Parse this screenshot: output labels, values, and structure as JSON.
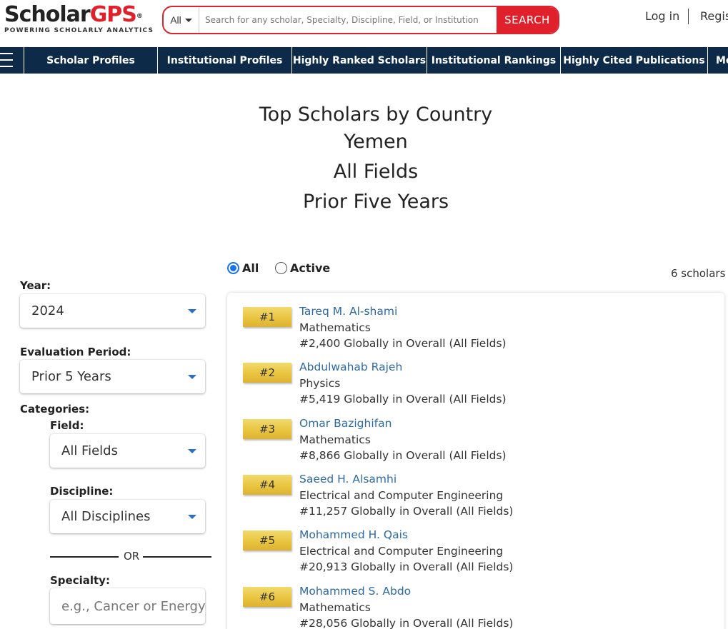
{
  "brand": {
    "name_part1": "Scholar",
    "name_part2": "GPS",
    "reg": "®",
    "tagline": "POWERING SCHOLARLY ANALYTICS"
  },
  "search": {
    "scope": "All",
    "placeholder": "Search for any scholar, Specialty, Discipline, Field, or Institution",
    "button": "SEARCH",
    "value": ""
  },
  "auth": {
    "login": "Log in",
    "register": "Register"
  },
  "nav": {
    "items": [
      "Scholar Profiles",
      "Institutional Profiles",
      "Highly Ranked Scholars",
      "Institutional Rankings",
      "Highly Cited Publications",
      "More"
    ]
  },
  "page": {
    "title": "Top Scholars by Country",
    "country": "Yemen",
    "field": "All Fields",
    "period": "Prior Five Years"
  },
  "filters": {
    "year_label": "Year:",
    "year_value": "2024",
    "eval_label": "Evaluation Period:",
    "eval_value": "Prior 5 Years",
    "categories_label": "Categories:",
    "field_label": "Field:",
    "field_value": "All Fields",
    "discipline_label": "Discipline:",
    "discipline_value": "All Disciplines",
    "or_text": "OR",
    "specialty_label": "Specialty:",
    "specialty_placeholder": "e.g., Cancer or Energy"
  },
  "toggle": {
    "all": "All",
    "active": "Active",
    "selected": "All"
  },
  "results": {
    "count": "6 scholars",
    "scholars": [
      {
        "rank": "#1",
        "name": "Tareq M. Al-shami",
        "field": "Mathematics",
        "global": "#2,400 Globally in Overall (All Fields)"
      },
      {
        "rank": "#2",
        "name": "Abdulwahab Rajeh",
        "field": "Physics",
        "global": "#5,419 Globally in Overall (All Fields)"
      },
      {
        "rank": "#3",
        "name": "Omar Bazighifan",
        "field": "Mathematics",
        "global": "#8,866 Globally in Overall (All Fields)"
      },
      {
        "rank": "#4",
        "name": "Saeed H. Alsamhi",
        "field": "Electrical and Computer Engineering",
        "global": "#11,257 Globally in Overall (All Fields)"
      },
      {
        "rank": "#5",
        "name": "Mohammed H. Qais",
        "field": "Electrical and Computer Engineering",
        "global": "#20,913 Globally in Overall (All Fields)"
      },
      {
        "rank": "#6",
        "name": "Mohammed S. Abdo",
        "field": "Mathematics",
        "global": "#28,056 Globally in Overall (All Fields)"
      }
    ]
  },
  "colors": {
    "brand_red": "#e0202a",
    "nav_bg": "#0d2b48",
    "link_blue": "#2d6aa3",
    "badge_gold": "#e9c53f",
    "accent_blue": "#1a73e8"
  }
}
